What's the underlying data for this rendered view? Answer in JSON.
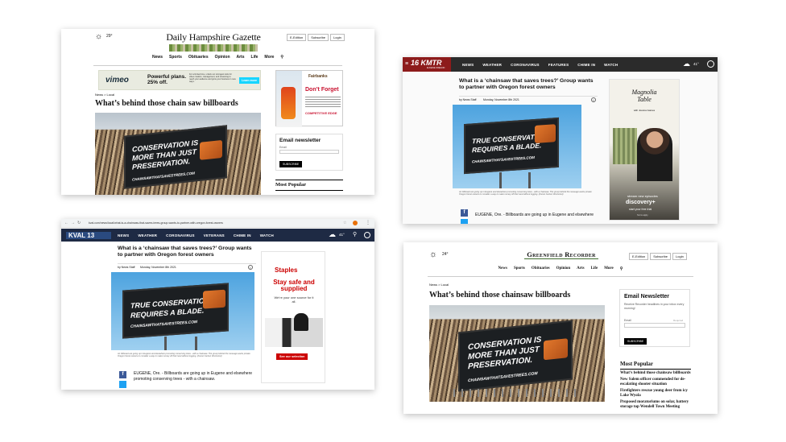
{
  "panel1": {
    "weather": "29°",
    "logo": "Daily Hampshire Gazette",
    "account": [
      "E-Edition",
      "Subscribe",
      "Login"
    ],
    "nav": [
      "News",
      "Sports",
      "Obituaries",
      "Opinion",
      "Arts",
      "Life",
      "More"
    ],
    "ad": {
      "brand": "vimeo",
      "headline": "Powerful plans. 25% off.",
      "body": "For a limited time, unlock our strongest tools for video creation, management, and streaming to reach your audience and grow your business in new ways.",
      "cta": "Learn more"
    },
    "breadcrumb": "News > Local",
    "headline": "What’s behind those chain saw billboards",
    "billboard_lines": [
      "CONSERVATION IS",
      "MORE THAN JUST",
      "PRESERVATION.",
      "CHAINSAWTHATSAVESTREES.COM"
    ],
    "side_ad": {
      "store": "Fairbanks",
      "title": "Don’t Forget",
      "sub": "COMPETITIVE EDGE"
    },
    "newsletter": {
      "title": "Email newsletter",
      "email_label": "Email",
      "button": "SUBSCRIBE"
    },
    "most_popular": "Most Popular"
  },
  "panel2": {
    "logo": "16 KMTR",
    "logo_sub": "EUGENE OREGON",
    "nav": [
      "NEWS",
      "WEATHER",
      "CORONAVIRUS",
      "FEATURES",
      "CHIME IN",
      "WATCH"
    ],
    "weather": "41°",
    "headline": "What is a ‘chainsaw that saves trees?’ Group wants to partner with Oregon forest owners",
    "byline": "by News Staff",
    "date": "Monday, November 8th 2021",
    "billboard_lines": [
      "TRUE CONSERVATION",
      "REQUIRES A BLADE.",
      "CHAINSAWTHATSAVESTREES.COM"
    ],
    "caption": "An billboard are going up in Eugene and elsewhere promoting conserving trees - with a chainsaw. The group behind the message wants private Oregon forest owners to consider a way to make money off their land without logging. (Forest Carbon Works/Ltd)",
    "body": "EUGENE, Ore. - Billboards are going up in Eugene and elsewhere",
    "ad": {
      "title": "Magnolia Table",
      "sub": "with Joanna Gaines",
      "line1": "stream new episodes",
      "brand": "discovery+",
      "cta": "start your free trial",
      "terms": "Terms apply."
    }
  },
  "panel3": {
    "url": "kval.com/news/local/what-is-a-chainsaw-that-saves-trees-group-wants-to-partner-with-oregon-forest-owners",
    "logo": "KVAL 13",
    "nav": [
      "NEWS",
      "WEATHER",
      "CORONAVIRUS",
      "VETERANS",
      "CHIME IN",
      "WATCH"
    ],
    "weather": "41°",
    "headline": "What is a ‘chainsaw that saves trees?’ Group wants to partner with Oregon forest owners",
    "byline": "by News Staff",
    "date": "Monday, November 8th 2021",
    "billboard_lines": [
      "TRUE CONSERVATION",
      "REQUIRES A BLADE.",
      "CHAINSAWTHATSAVESTREES.COM"
    ],
    "caption": "An billboard are going up in Eugene and elsewhere promoting conserving trees - with a chainsaw. The group behind the message wants private Oregon forest owners to consider a way to make money off their land without logging. (Forest Carbon Works/Ltd)",
    "body1": "EUGENE, Ore. - Billboards are going up in Eugene and elsewhere",
    "body2": "promoting conserving trees - with a chainsaw.",
    "ad": {
      "brand": "Staples",
      "headline": "Stay safe and supplied",
      "sub": "We’re your one source for it all.",
      "cta": "See our selection"
    }
  },
  "panel4": {
    "weather": "24°",
    "logo": "Greenfield Recorder",
    "account": [
      "E-Edition",
      "Subscribe",
      "Login"
    ],
    "nav": [
      "News",
      "Sports",
      "Obituaries",
      "Opinion",
      "Arts",
      "Life",
      "More"
    ],
    "breadcrumb": "News > Local",
    "headline": "What’s behind those chainsaw billboards",
    "billboard_lines": [
      "CONSERVATION IS",
      "MORE THAN JUST",
      "PRESERVATION.",
      "CHAINSAWTHATSAVESTREES.COM"
    ],
    "newsletter": {
      "title": "Email Newsletter",
      "desc": "Receive Recorder headlines in your inbox every morning!",
      "email_label": "Email",
      "required": "Required",
      "button": "SUBSCRIBE"
    },
    "most_popular": "Most Popular",
    "popular": [
      "What’s behind those chainsaw billboards",
      "New Salem officer commended for de-escalating shooter situation",
      "Firefighters rescue young deer from icy Lake Wyola",
      "Proposed moratoriums on solar, battery storage top Wendell Town Meeting"
    ]
  }
}
